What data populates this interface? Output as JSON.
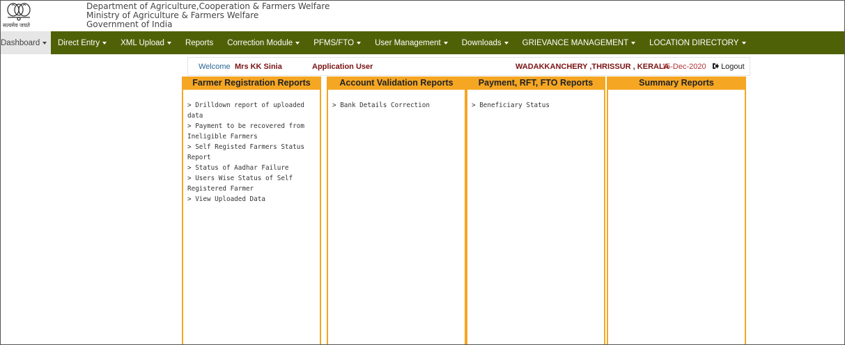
{
  "header": {
    "emblem_caption": "सत्यमेव जयते",
    "lines": [
      "Department of Agriculture,Cooperation & Farmers Welfare",
      "Ministry of Agriculture & Farmers Welfare",
      "Government of India"
    ]
  },
  "navbar": {
    "items": [
      {
        "label": "Dashboard",
        "dropdown": true
      },
      {
        "label": "Direct Entry",
        "dropdown": true
      },
      {
        "label": "XML Upload",
        "dropdown": true
      },
      {
        "label": "Reports",
        "dropdown": false
      },
      {
        "label": "Correction Module",
        "dropdown": true
      },
      {
        "label": "PFMS/FTO",
        "dropdown": true
      },
      {
        "label": "User Management",
        "dropdown": true
      },
      {
        "label": "Downloads",
        "dropdown": true
      },
      {
        "label": "GRIEVANCE MANAGEMENT",
        "dropdown": true
      },
      {
        "label": "LOCATION DIRECTORY",
        "dropdown": true
      }
    ],
    "color": "#4f6107"
  },
  "welcome": {
    "prefix": "Welcome",
    "user": "Mrs KK Sinia",
    "role": "Application User",
    "location": "WADAKKANCHERY ,THRISSUR , KERALA",
    "date": "15-Dec-2020",
    "logout": "Logout"
  },
  "columns": [
    {
      "title": "Farmer Registration Reports",
      "items": [
        "> Drilldown report of uploaded data",
        "> Payment to be recovered from Ineligible Farmers",
        "> Self Registed Farmers Status Report",
        "> Status of Aadhar Failure",
        "> Users Wise Status of Self Registered Farmer",
        "> View Uploaded Data"
      ]
    },
    {
      "title": "Account Validation Reports",
      "items": [
        "> Bank Details Correction"
      ]
    },
    {
      "title": "Payment, RFT, FTO Reports",
      "items": [
        "> Beneficiary Status"
      ]
    },
    {
      "title": "Summary Reports",
      "items": []
    }
  ],
  "colors": {
    "accent": "#f5a623",
    "brand": "#4f6107",
    "user_text": "#7a1212"
  }
}
